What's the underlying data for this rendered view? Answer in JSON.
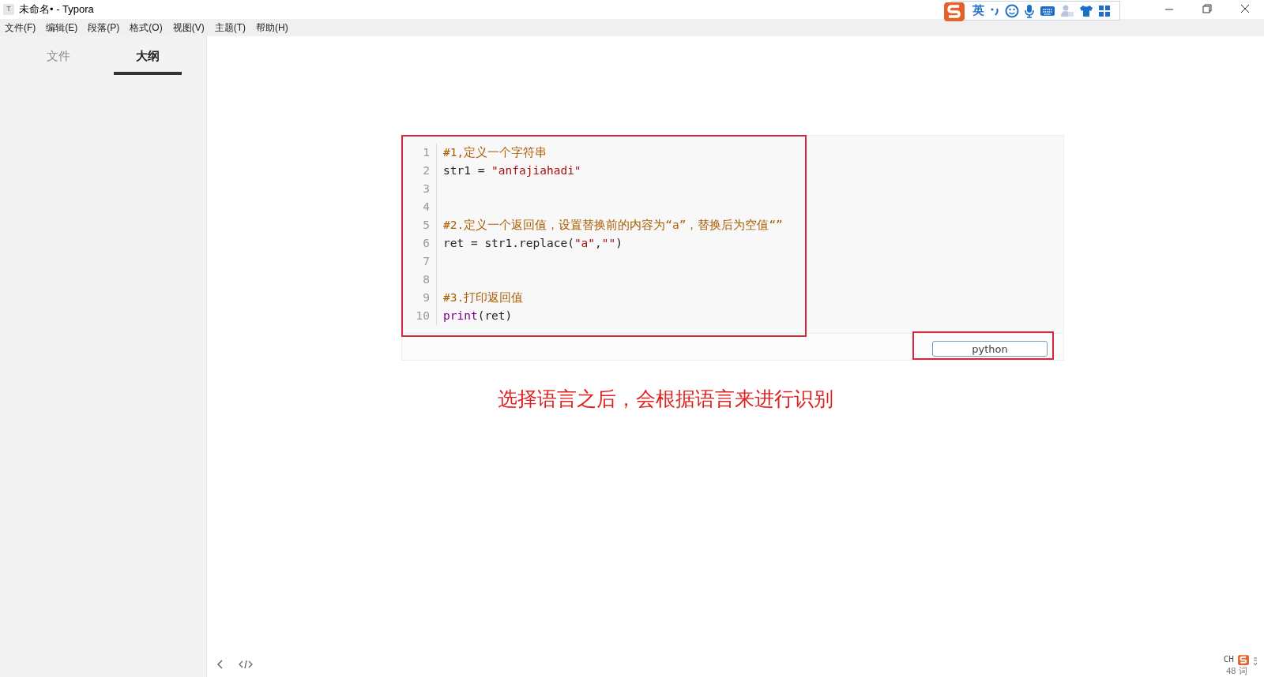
{
  "window": {
    "app_icon_letter": "T",
    "title": "未命名• - Typora"
  },
  "ime_toolbar": {
    "language": "英"
  },
  "menu": [
    {
      "label": "文件(F)"
    },
    {
      "label": "编辑(E)"
    },
    {
      "label": "段落(P)"
    },
    {
      "label": "格式(O)"
    },
    {
      "label": "视图(V)"
    },
    {
      "label": "主题(T)"
    },
    {
      "label": "帮助(H)"
    }
  ],
  "sidebar": {
    "tabs": [
      {
        "label": "文件",
        "selected": false
      },
      {
        "label": "大纲",
        "selected": true
      }
    ]
  },
  "code_block": {
    "lines": [
      {
        "number": "1",
        "tokens": [
          {
            "kind": "comment",
            "text": "#1,定义一个字符串"
          }
        ]
      },
      {
        "number": "2",
        "tokens": [
          {
            "kind": "plain",
            "text": "str1 = "
          },
          {
            "kind": "string",
            "text": "\"anfajiahadi\""
          }
        ]
      },
      {
        "number": "3"
      },
      {
        "number": "4"
      },
      {
        "number": "5",
        "tokens": [
          {
            "kind": "comment",
            "text": "#2.定义一个返回值，设置替换前的内容为“a”，替换后为空值“”"
          }
        ]
      },
      {
        "number": "6",
        "tokens": [
          {
            "kind": "plain",
            "text": "ret = str1.replace("
          },
          {
            "kind": "string",
            "text": "\"a\""
          },
          {
            "kind": "plain",
            "text": ","
          },
          {
            "kind": "string",
            "text": "\"\""
          },
          {
            "kind": "plain",
            "text": ")"
          }
        ]
      },
      {
        "number": "7"
      },
      {
        "number": "8"
      },
      {
        "number": "9",
        "tokens": [
          {
            "kind": "comment",
            "text": "#3.打印返回值"
          }
        ]
      },
      {
        "number": "10",
        "tokens": [
          {
            "kind": "builtin",
            "text": "print"
          },
          {
            "kind": "plain",
            "text": "(ret)"
          }
        ]
      }
    ],
    "language": "python"
  },
  "annotation": "选择语言之后，会根据语言来进行识别",
  "status": {
    "ime": "CH",
    "word_count": "48 词"
  }
}
